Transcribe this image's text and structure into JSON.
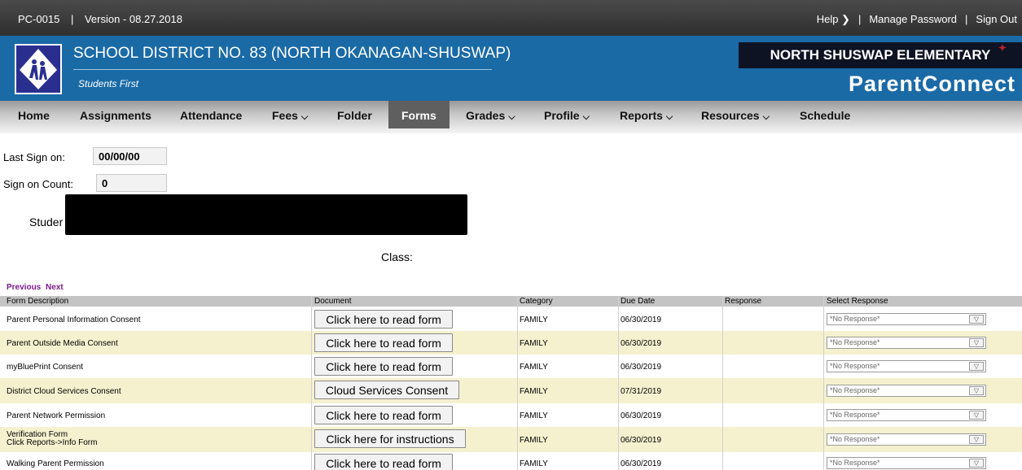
{
  "topbar": {
    "code": "PC-0015",
    "separator": "|",
    "version": "Version - 08.27.2018",
    "help": "Help ❯",
    "pipe": "|",
    "manage_password": "Manage Password",
    "pipe2": "|",
    "sign_out": "Sign Out"
  },
  "header": {
    "district": "SCHOOL DISTRICT NO. 83 (NORTH OKANAGAN-SHUSWAP)",
    "tagline": "Students First",
    "school": "NORTH SHUSWAP ELEMENTARY",
    "app": "ParentConnect",
    "bg": "#1a6aa6"
  },
  "nav": {
    "items": [
      {
        "label": "Home"
      },
      {
        "label": "Assignments"
      },
      {
        "label": "Attendance"
      },
      {
        "label": "Fees"
      },
      {
        "label": "Folder"
      },
      {
        "label": "Forms"
      },
      {
        "label": "Grades"
      },
      {
        "label": "Profile"
      },
      {
        "label": "Reports"
      },
      {
        "label": "Resources"
      },
      {
        "label": "Schedule"
      }
    ],
    "active": "Forms",
    "chevron": "❯"
  },
  "info": {
    "last_sign_on_label": "Last Sign on:",
    "last_sign_on_value": "00/00/00",
    "sign_on_count_label": "Sign on Count:",
    "sign_on_count_value": "0",
    "student_label": "Studer",
    "class_label": "Class:"
  },
  "pager": {
    "previous": "Previous",
    "next": "Next"
  },
  "table": {
    "headers": [
      "Form Description",
      "Document",
      "Category",
      "Due Date",
      "Response",
      "Select Response"
    ],
    "rows": [
      {
        "desc": "Parent Personal Information Consent",
        "desc2": "",
        "button": "Click here to read form",
        "category": "FAMILY",
        "due": "06/30/2019",
        "response": "",
        "select": "*No Response*"
      },
      {
        "desc": "Parent Outside Media Consent",
        "desc2": "",
        "button": "Click here to read form",
        "category": "FAMILY",
        "due": "06/30/2019",
        "response": "",
        "select": "*No Response*"
      },
      {
        "desc": "myBluePrint Consent",
        "desc2": "",
        "button": "Click here to read form",
        "category": "FAMILY",
        "due": "06/30/2019",
        "response": "",
        "select": "*No Response*"
      },
      {
        "desc": "District Cloud Services Consent",
        "desc2": "",
        "button": "Cloud Services Consent",
        "category": "FAMILY",
        "due": "07/31/2019",
        "response": "",
        "select": "*No Response*"
      },
      {
        "desc": "Parent Network Permission",
        "desc2": "",
        "button": "Click here to read form",
        "category": "FAMILY",
        "due": "06/30/2019",
        "response": "",
        "select": "*No Response*"
      },
      {
        "desc": "Verification Form",
        "desc2": "Click Reports->Info Form",
        "button": "Click here for instructions",
        "category": "FAMILY",
        "due": "06/30/2019",
        "response": "",
        "select": "*No Response*"
      },
      {
        "desc": "Walking Parent Permission",
        "desc2": "",
        "button": "Click here to read form",
        "category": "FAMILY",
        "due": "06/30/2019",
        "response": "",
        "select": "*No Response*"
      }
    ]
  },
  "icons": {
    "dropdown": "chevron-down-icon",
    "select_arrow": "▽"
  }
}
